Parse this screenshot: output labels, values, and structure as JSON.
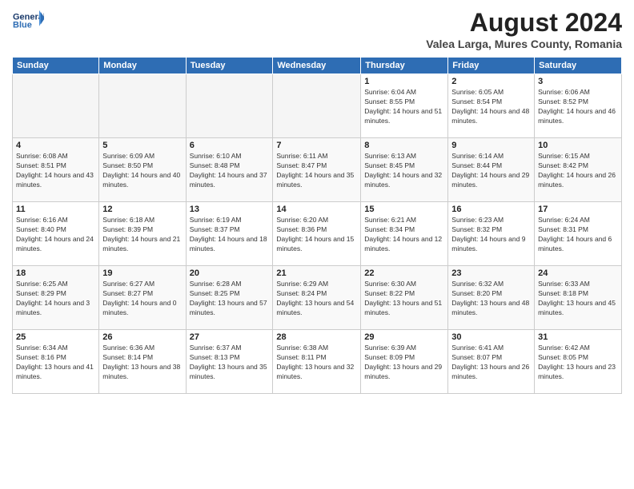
{
  "header": {
    "logo_line1": "General",
    "logo_line2": "Blue",
    "month_year": "August 2024",
    "location": "Valea Larga, Mures County, Romania"
  },
  "weekdays": [
    "Sunday",
    "Monday",
    "Tuesday",
    "Wednesday",
    "Thursday",
    "Friday",
    "Saturday"
  ],
  "weeks": [
    [
      {
        "day": "",
        "info": ""
      },
      {
        "day": "",
        "info": ""
      },
      {
        "day": "",
        "info": ""
      },
      {
        "day": "",
        "info": ""
      },
      {
        "day": "1",
        "info": "Sunrise: 6:04 AM\nSunset: 8:55 PM\nDaylight: 14 hours and 51 minutes."
      },
      {
        "day": "2",
        "info": "Sunrise: 6:05 AM\nSunset: 8:54 PM\nDaylight: 14 hours and 48 minutes."
      },
      {
        "day": "3",
        "info": "Sunrise: 6:06 AM\nSunset: 8:52 PM\nDaylight: 14 hours and 46 minutes."
      }
    ],
    [
      {
        "day": "4",
        "info": "Sunrise: 6:08 AM\nSunset: 8:51 PM\nDaylight: 14 hours and 43 minutes."
      },
      {
        "day": "5",
        "info": "Sunrise: 6:09 AM\nSunset: 8:50 PM\nDaylight: 14 hours and 40 minutes."
      },
      {
        "day": "6",
        "info": "Sunrise: 6:10 AM\nSunset: 8:48 PM\nDaylight: 14 hours and 37 minutes."
      },
      {
        "day": "7",
        "info": "Sunrise: 6:11 AM\nSunset: 8:47 PM\nDaylight: 14 hours and 35 minutes."
      },
      {
        "day": "8",
        "info": "Sunrise: 6:13 AM\nSunset: 8:45 PM\nDaylight: 14 hours and 32 minutes."
      },
      {
        "day": "9",
        "info": "Sunrise: 6:14 AM\nSunset: 8:44 PM\nDaylight: 14 hours and 29 minutes."
      },
      {
        "day": "10",
        "info": "Sunrise: 6:15 AM\nSunset: 8:42 PM\nDaylight: 14 hours and 26 minutes."
      }
    ],
    [
      {
        "day": "11",
        "info": "Sunrise: 6:16 AM\nSunset: 8:40 PM\nDaylight: 14 hours and 24 minutes."
      },
      {
        "day": "12",
        "info": "Sunrise: 6:18 AM\nSunset: 8:39 PM\nDaylight: 14 hours and 21 minutes."
      },
      {
        "day": "13",
        "info": "Sunrise: 6:19 AM\nSunset: 8:37 PM\nDaylight: 14 hours and 18 minutes."
      },
      {
        "day": "14",
        "info": "Sunrise: 6:20 AM\nSunset: 8:36 PM\nDaylight: 14 hours and 15 minutes."
      },
      {
        "day": "15",
        "info": "Sunrise: 6:21 AM\nSunset: 8:34 PM\nDaylight: 14 hours and 12 minutes."
      },
      {
        "day": "16",
        "info": "Sunrise: 6:23 AM\nSunset: 8:32 PM\nDaylight: 14 hours and 9 minutes."
      },
      {
        "day": "17",
        "info": "Sunrise: 6:24 AM\nSunset: 8:31 PM\nDaylight: 14 hours and 6 minutes."
      }
    ],
    [
      {
        "day": "18",
        "info": "Sunrise: 6:25 AM\nSunset: 8:29 PM\nDaylight: 14 hours and 3 minutes."
      },
      {
        "day": "19",
        "info": "Sunrise: 6:27 AM\nSunset: 8:27 PM\nDaylight: 14 hours and 0 minutes."
      },
      {
        "day": "20",
        "info": "Sunrise: 6:28 AM\nSunset: 8:25 PM\nDaylight: 13 hours and 57 minutes."
      },
      {
        "day": "21",
        "info": "Sunrise: 6:29 AM\nSunset: 8:24 PM\nDaylight: 13 hours and 54 minutes."
      },
      {
        "day": "22",
        "info": "Sunrise: 6:30 AM\nSunset: 8:22 PM\nDaylight: 13 hours and 51 minutes."
      },
      {
        "day": "23",
        "info": "Sunrise: 6:32 AM\nSunset: 8:20 PM\nDaylight: 13 hours and 48 minutes."
      },
      {
        "day": "24",
        "info": "Sunrise: 6:33 AM\nSunset: 8:18 PM\nDaylight: 13 hours and 45 minutes."
      }
    ],
    [
      {
        "day": "25",
        "info": "Sunrise: 6:34 AM\nSunset: 8:16 PM\nDaylight: 13 hours and 41 minutes."
      },
      {
        "day": "26",
        "info": "Sunrise: 6:36 AM\nSunset: 8:14 PM\nDaylight: 13 hours and 38 minutes."
      },
      {
        "day": "27",
        "info": "Sunrise: 6:37 AM\nSunset: 8:13 PM\nDaylight: 13 hours and 35 minutes."
      },
      {
        "day": "28",
        "info": "Sunrise: 6:38 AM\nSunset: 8:11 PM\nDaylight: 13 hours and 32 minutes."
      },
      {
        "day": "29",
        "info": "Sunrise: 6:39 AM\nSunset: 8:09 PM\nDaylight: 13 hours and 29 minutes."
      },
      {
        "day": "30",
        "info": "Sunrise: 6:41 AM\nSunset: 8:07 PM\nDaylight: 13 hours and 26 minutes."
      },
      {
        "day": "31",
        "info": "Sunrise: 6:42 AM\nSunset: 8:05 PM\nDaylight: 13 hours and 23 minutes."
      }
    ]
  ]
}
